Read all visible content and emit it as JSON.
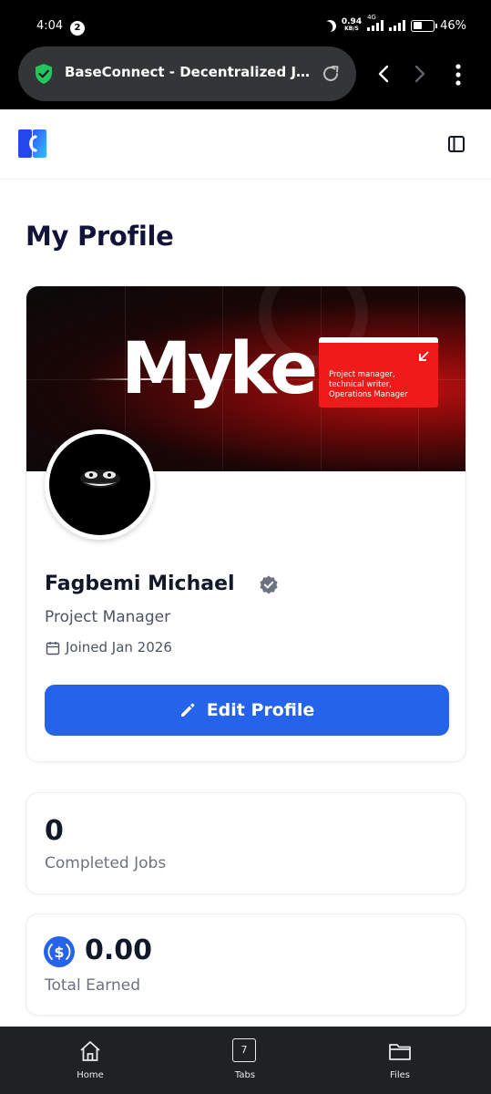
{
  "status_bar": {
    "time": "4:04",
    "notification_count": "2",
    "net_speed": "0.94",
    "net_speed_unit": "KB/S",
    "network_type": "4G",
    "battery": "46%",
    "battery_level": 0.46
  },
  "browser": {
    "url_title": "BaseConnect - Decentralized Job Mar…",
    "security_color": "#22c55e"
  },
  "header": {
    "logo_icon": "baseconnect-logo-icon",
    "menu_icon": "sidebar-toggle-icon"
  },
  "page": {
    "title": "My Profile"
  },
  "profile": {
    "banner": {
      "name": "Myke",
      "tagline": [
        "Project manager,",
        "technical writer,",
        "Operations Manager"
      ],
      "accent": "#ef1b1b"
    },
    "name": "Fagbemi Michael",
    "verified": true,
    "role": "Project Manager",
    "joined": "Joined Jan 2026",
    "edit_button": "Edit Profile",
    "accent": "#2563eb"
  },
  "stats": {
    "completed_jobs_value": "0",
    "completed_jobs_label": "Completed Jobs",
    "total_earned_value": "0.00",
    "total_earned_label": "Total Earned",
    "currency_icon": "usdc-icon",
    "currency_color": "#2563eb"
  },
  "bottom_nav": {
    "home": "Home",
    "tabs": "Tabs",
    "tabs_count": "7",
    "files": "Files"
  }
}
